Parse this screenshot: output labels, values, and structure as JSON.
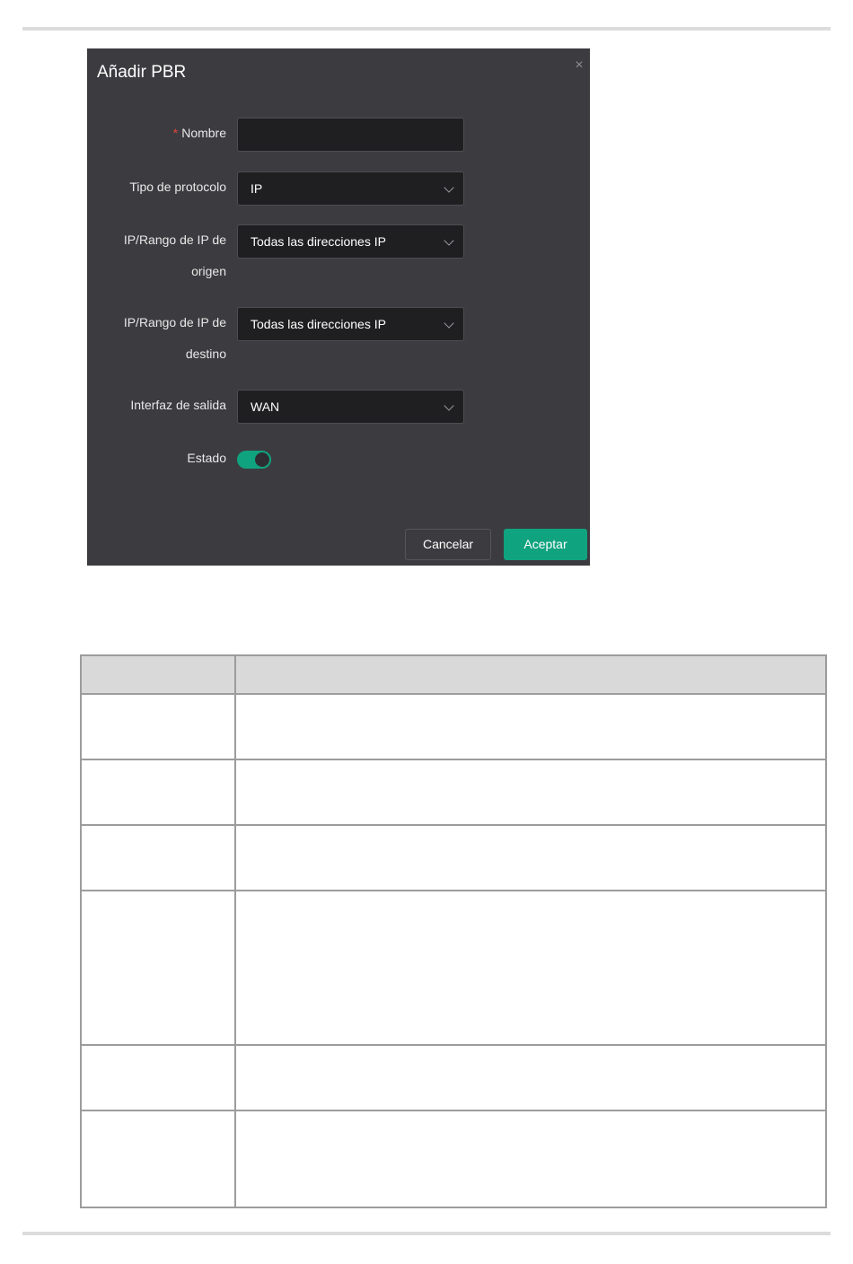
{
  "dialog": {
    "title": "Añadir PBR",
    "close_symbol": "×",
    "fields": {
      "name": {
        "label": "Nombre",
        "required_mark": "*",
        "value": ""
      },
      "protocol": {
        "label": "Tipo de protocolo",
        "value": "IP"
      },
      "source_ip": {
        "label_line1": "IP/Rango de IP de",
        "label_line2": "origen",
        "value": "Todas las direcciones IP"
      },
      "dest_ip": {
        "label_line1": "IP/Rango de IP de",
        "label_line2": "destino",
        "value": "Todas las direcciones IP"
      },
      "egress": {
        "label": "Interfaz de salida",
        "value": "WAN"
      },
      "status": {
        "label": "Estado",
        "enabled": true
      }
    },
    "buttons": {
      "cancel": "Cancelar",
      "ok": "Aceptar"
    }
  },
  "colors": {
    "dialog_bg": "#3c3c40",
    "input_bg": "#1f1f21",
    "accent": "#10a37f",
    "required": "#e0443e"
  },
  "icons": {
    "close": "close-icon",
    "dropdown": "chevron-down-icon"
  },
  "table": {
    "rows": 6
  }
}
